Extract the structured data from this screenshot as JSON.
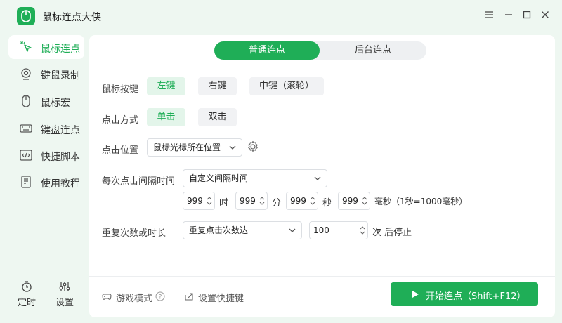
{
  "app": {
    "title": "鼠标连点大侠"
  },
  "sidebar": {
    "items": [
      {
        "label": "鼠标连点"
      },
      {
        "label": "键鼠录制"
      },
      {
        "label": "鼠标宏"
      },
      {
        "label": "键盘连点"
      },
      {
        "label": "快捷脚本"
      },
      {
        "label": "使用教程"
      }
    ],
    "bottom": [
      {
        "label": "定时"
      },
      {
        "label": "设置"
      }
    ]
  },
  "tabs": [
    {
      "label": "普通连点",
      "active": true
    },
    {
      "label": "后台连点",
      "active": false
    }
  ],
  "mouse_button": {
    "label": "鼠标按键",
    "options": [
      {
        "label": "左键",
        "selected": true
      },
      {
        "label": "右键"
      },
      {
        "label": "中键（滚轮）"
      }
    ]
  },
  "click_mode": {
    "label": "点击方式",
    "options": [
      {
        "label": "单击",
        "selected": true
      },
      {
        "label": "双击"
      }
    ]
  },
  "click_position": {
    "label": "点击位置",
    "value": "鼠标光标所在位置"
  },
  "interval": {
    "label": "每次点击间隔时间",
    "mode": "自定义间隔时间",
    "hours": "999",
    "hours_unit": "时",
    "minutes": "999",
    "minutes_unit": "分",
    "seconds": "999",
    "seconds_unit": "秒",
    "ms": "999",
    "ms_unit": "毫秒（1秒=1000毫秒）"
  },
  "repeat": {
    "label": "重复次数或时长",
    "mode": "重复点击次数达",
    "count": "100",
    "suffix": "次 后停止"
  },
  "footer": {
    "game_mode": "游戏模式",
    "hotkey": "设置快捷键",
    "start": "开始连点（Shift+F12）"
  },
  "colors": {
    "accent": "#1fae57",
    "accent_light": "#e3f5ea",
    "background": "#eef7f1"
  }
}
